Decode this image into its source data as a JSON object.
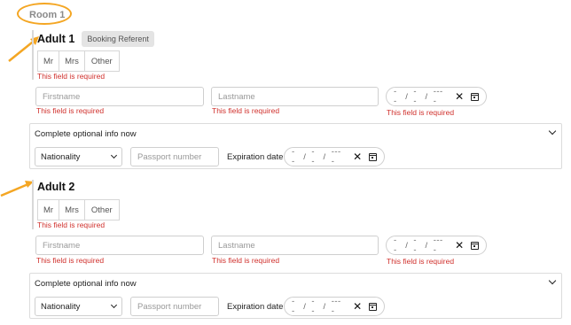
{
  "room": {
    "title": "Room 1"
  },
  "adults": [
    {
      "title": "Adult 1",
      "badge": "Booking Referent",
      "title_options": [
        "Mr",
        "Mrs",
        "Other"
      ],
      "title_error": "This field is required",
      "firstname_placeholder": "Firstname",
      "firstname_error": "This field is required",
      "lastname_placeholder": "Lastname",
      "lastname_error": "This field is required",
      "dob": {
        "day": "--",
        "month": "--",
        "year": "----",
        "sep": "/"
      },
      "dob_error": "This field is required",
      "optional": {
        "title": "Complete optional info now",
        "nationality": "Nationality",
        "passport_placeholder": "Passport number",
        "expiration_label": "Expiration date",
        "expiration": {
          "day": "--",
          "month": "--",
          "year": "----",
          "sep": "/"
        }
      }
    },
    {
      "title": "Adult 2",
      "title_options": [
        "Mr",
        "Mrs",
        "Other"
      ],
      "title_error": "This field is required",
      "firstname_placeholder": "Firstname",
      "firstname_error": "This field is required",
      "lastname_placeholder": "Lastname",
      "lastname_error": "This field is required",
      "dob": {
        "day": "--",
        "month": "--",
        "year": "----",
        "sep": "/"
      },
      "dob_error": "This field is required",
      "optional": {
        "title": "Complete optional info now",
        "nationality": "Nationality",
        "passport_placeholder": "Passport number",
        "expiration_label": "Expiration date",
        "expiration": {
          "day": "--",
          "month": "--",
          "year": "----",
          "sep": "/"
        }
      }
    }
  ],
  "colors": {
    "accent_annotation": "#f4a623",
    "error": "#d0312d",
    "badge_bg": "#e4e4e4"
  },
  "icons": {
    "clear": "close-icon",
    "calendar": "calendar-icon",
    "expand": "chevron-down-icon",
    "annotation": "arrow-annotation-icon"
  }
}
